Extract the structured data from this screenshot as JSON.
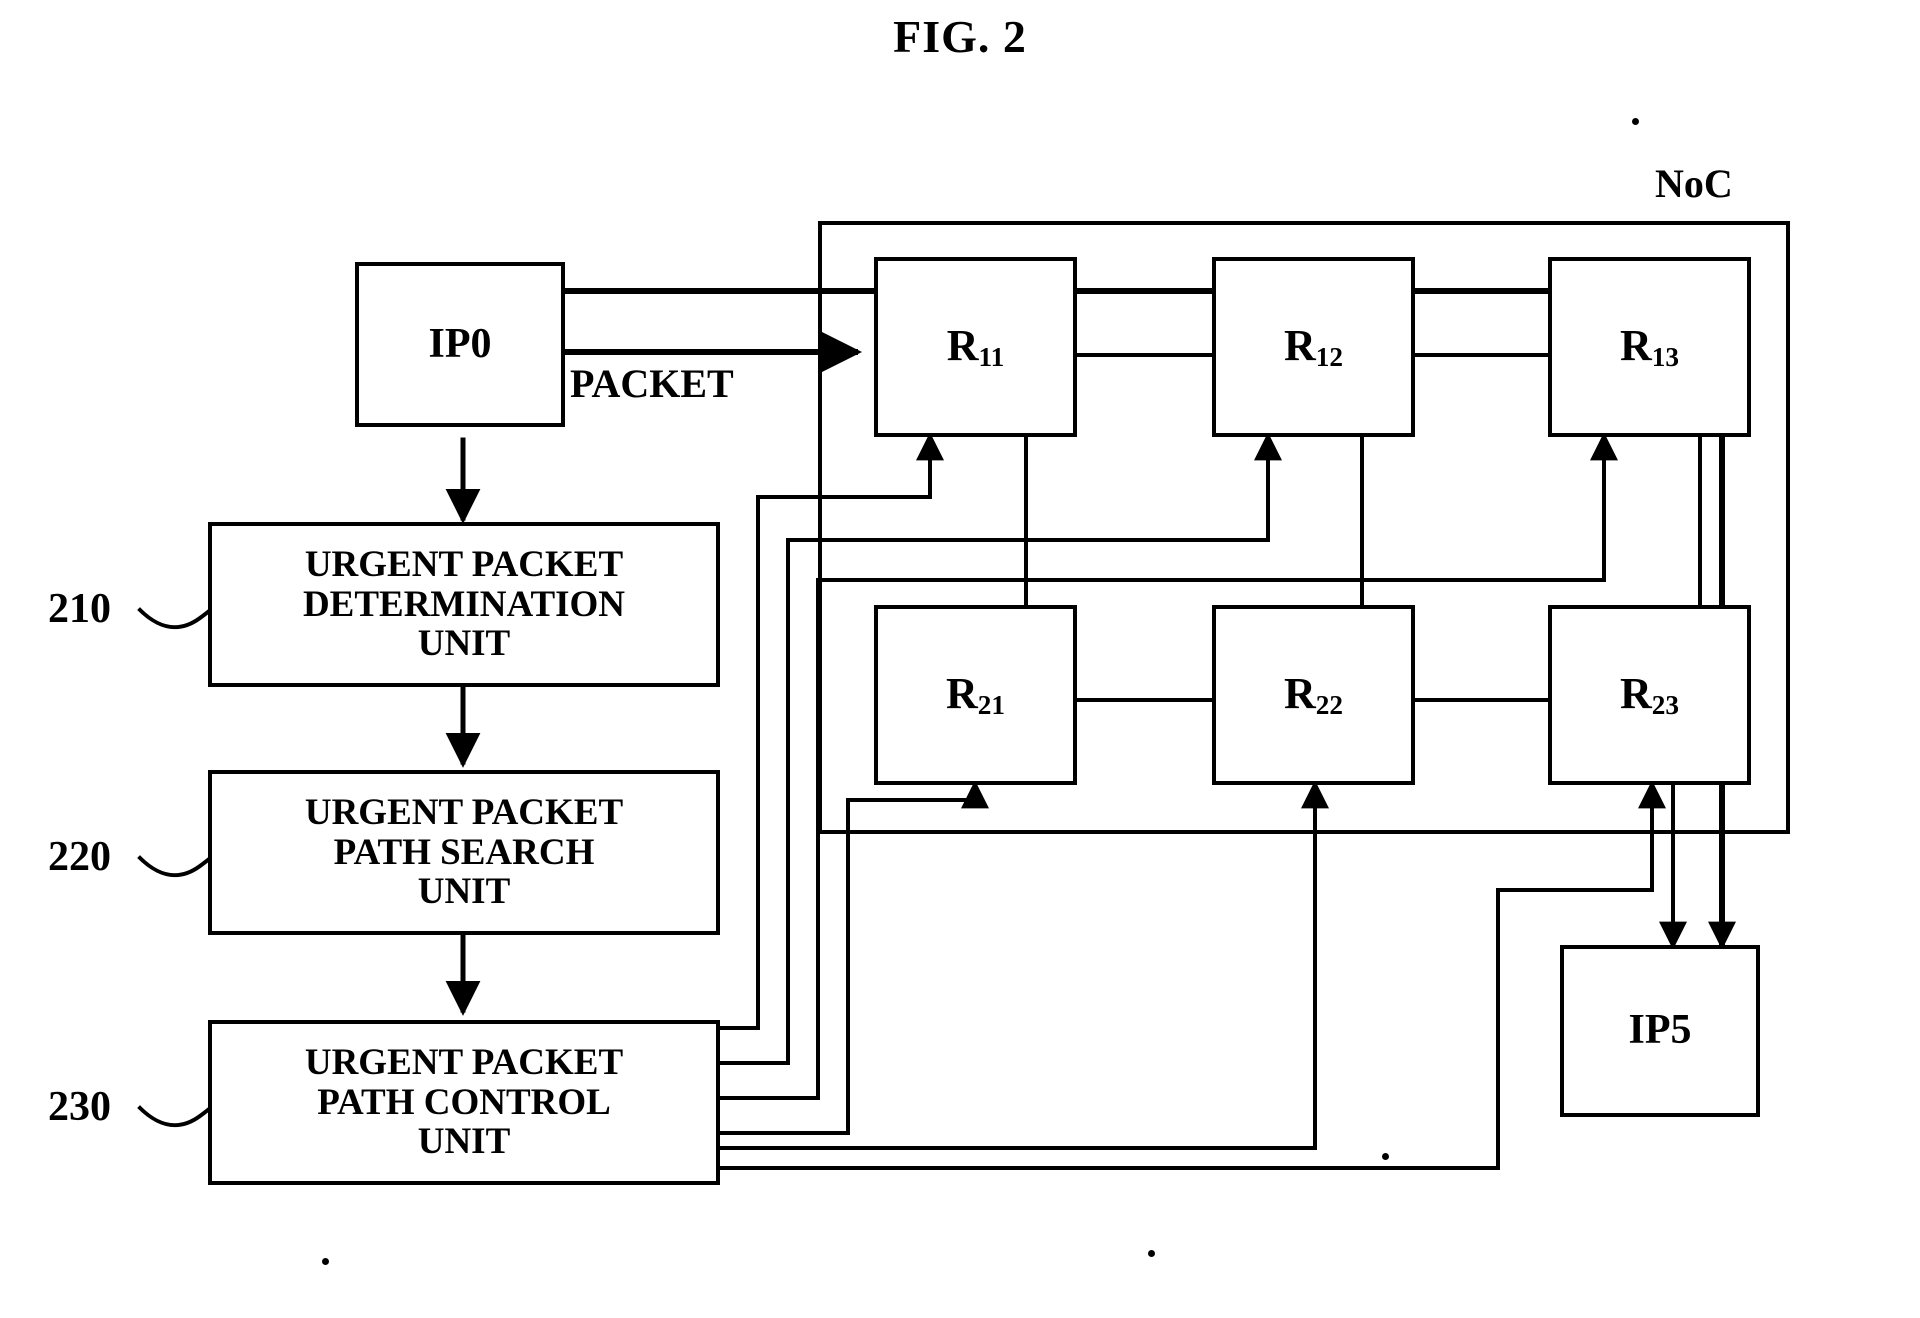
{
  "figure": {
    "title": "FIG. 2",
    "noc_label": "NoC",
    "packet_label": "PACKET"
  },
  "left_column": {
    "source_block": {
      "label": "IP0",
      "ref": ""
    },
    "units": [
      {
        "ref": "210",
        "lines": [
          "URGENT PACKET",
          "DETERMINATION",
          "UNIT"
        ],
        "text": "URGENT PACKET DETERMINATION UNIT"
      },
      {
        "ref": "220",
        "lines": [
          "URGENT PACKET",
          "PATH SEARCH",
          "UNIT"
        ],
        "text": "URGENT PACKET PATH SEARCH UNIT"
      },
      {
        "ref": "230",
        "lines": [
          "URGENT PACKET",
          "PATH CONTROL",
          "UNIT"
        ],
        "text": "URGENT PACKET PATH CONTROL UNIT"
      }
    ]
  },
  "noc": {
    "label": "NoC",
    "routers": [
      {
        "name": "R11",
        "base": "R",
        "sub": "11",
        "row": 1,
        "col": 1
      },
      {
        "name": "R12",
        "base": "R",
        "sub": "12",
        "row": 1,
        "col": 2
      },
      {
        "name": "R13",
        "base": "R",
        "sub": "13",
        "row": 1,
        "col": 3
      },
      {
        "name": "R21",
        "base": "R",
        "sub": "21",
        "row": 2,
        "col": 1
      },
      {
        "name": "R22",
        "base": "R",
        "sub": "22",
        "row": 2,
        "col": 2
      },
      {
        "name": "R23",
        "base": "R",
        "sub": "23",
        "row": 2,
        "col": 3
      }
    ],
    "destination_block": {
      "label": "IP5"
    }
  },
  "colors": {
    "ink": "#000000",
    "paper": "#ffffff"
  }
}
